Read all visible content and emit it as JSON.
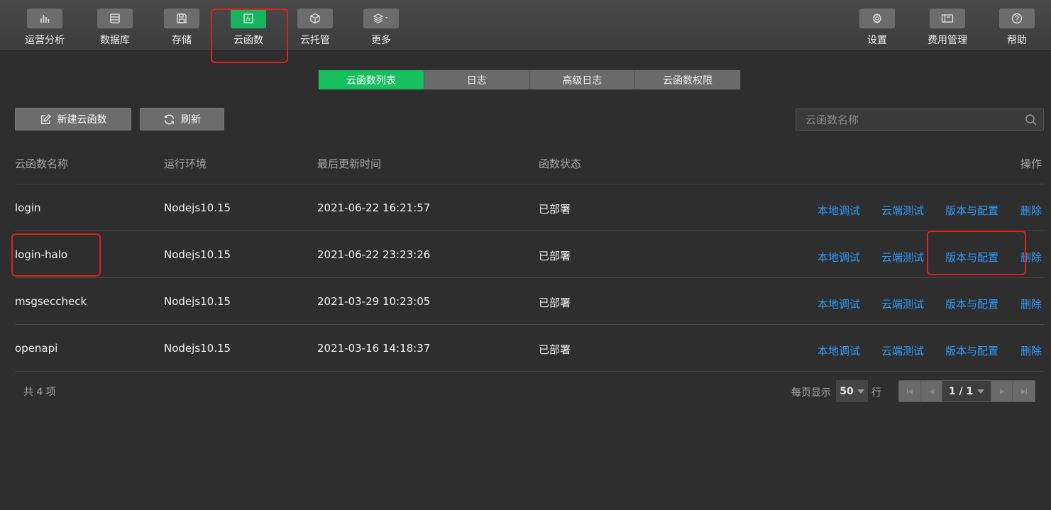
{
  "toolbar": {
    "left": [
      {
        "label": "运营分析",
        "icon": "bar-chart-icon"
      },
      {
        "label": "数据库",
        "icon": "database-icon"
      },
      {
        "label": "存储",
        "icon": "floppy-disk-icon"
      },
      {
        "label": "云函数",
        "icon": "function-fx-icon"
      },
      {
        "label": "云托管",
        "icon": "cube-icon"
      },
      {
        "label": "更多",
        "icon": "layers-icon"
      }
    ],
    "right": [
      {
        "label": "设置",
        "icon": "gear-icon"
      },
      {
        "label": "费用管理",
        "icon": "billing-icon"
      },
      {
        "label": "帮助",
        "icon": "help-icon"
      }
    ],
    "fx_text": "fx",
    "active_color": "#16b45f",
    "highlight_color": "#e0211b"
  },
  "tabs": [
    "云函数列表",
    "日志",
    "高级日志",
    "云函数权限"
  ],
  "actions": {
    "new_label": "新建云函数",
    "refresh_label": "刷新"
  },
  "search": {
    "placeholder": "云函数名称",
    "value": ""
  },
  "table": {
    "columns": [
      "云函数名称",
      "运行环境",
      "最后更新时间",
      "函数状态",
      "操作"
    ],
    "rows": [
      {
        "name": "login",
        "runtime": "Nodejs10.15",
        "updated": "2021-06-22 16:21:57",
        "status": "已部署"
      },
      {
        "name": "login-halo",
        "runtime": "Nodejs10.15",
        "updated": "2021-06-22 23:23:26",
        "status": "已部署"
      },
      {
        "name": "msgseccheck",
        "runtime": "Nodejs10.15",
        "updated": "2021-03-29 10:23:05",
        "status": "已部署"
      },
      {
        "name": "openapi",
        "runtime": "Nodejs10.15",
        "updated": "2021-03-16 14:18:37",
        "status": "已部署"
      }
    ],
    "ops": [
      "本地调试",
      "云端测试",
      "版本与配置",
      "删除"
    ],
    "link_color": "#2e9bff"
  },
  "footer": {
    "total": "共 4 项",
    "page_size_label": "每页显示",
    "page_size": "50",
    "page_size_unit": "行",
    "page_indicator": "1 / 1"
  }
}
